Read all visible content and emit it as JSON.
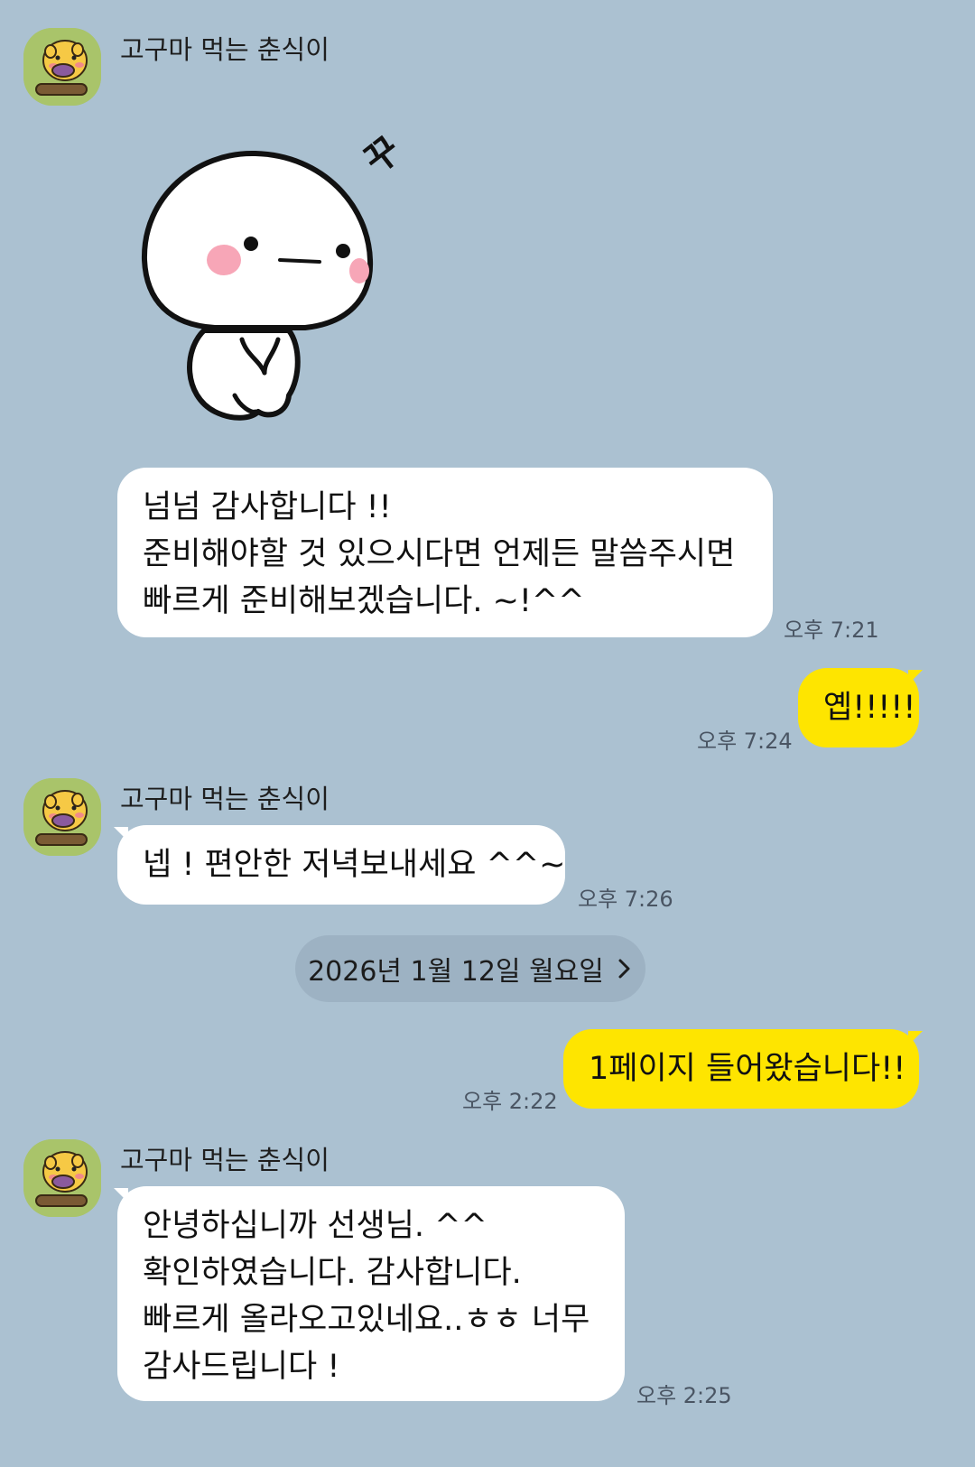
{
  "chat": {
    "sender_name": "고구마 먹는 춘식이",
    "messages": {
      "m1": {
        "lines": [
          "넘넘 감사합니다 !!",
          "준비해야할 것 있으시다면 언제든 말씀주시면",
          "빠르게 준비해보겠습니다. ~!^^"
        ],
        "time": "오후 7:21"
      },
      "m2": {
        "text": "옙!!!!!",
        "time": "오후 7:24"
      },
      "m3": {
        "text": "넵 ! 편안한 저녁보내세요 ^^~",
        "time": "오후 7:26"
      },
      "m4": {
        "text": "1페이지 들어왔습니다!!",
        "time": "오후 2:22"
      },
      "m5": {
        "lines": [
          "안녕하십니까 선생님. ^^",
          "확인하였습니다. 감사합니다.",
          "빠르게 올라오고있네요..ㅎㅎ 너무",
          "감사드립니다 !"
        ],
        "time": "오후 2:25"
      }
    },
    "date_divider": "2026년 1월 12일 월요일",
    "sticker": {
      "name": "white-blob-character-sticker",
      "sound_text": "꾸"
    }
  },
  "colors": {
    "background": "#abc1d1",
    "incoming_bubble": "#ffffff",
    "outgoing_bubble": "#fee500",
    "avatar_bg": "#a9c46a"
  },
  "icons": {
    "avatar": "chunsik-eating-sweet-potato-avatar",
    "date_chevron": "chevron-right-icon"
  }
}
